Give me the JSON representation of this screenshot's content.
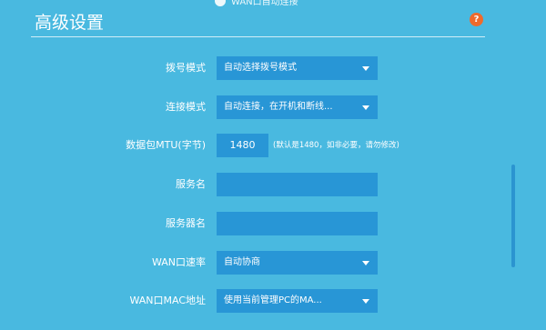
{
  "top_option": {
    "label": "WAN口自动连接"
  },
  "section": {
    "title": "高级设置",
    "help_icon": "question-icon"
  },
  "form": {
    "dial_mode": {
      "label": "拨号模式",
      "value": "自动选择拨号模式"
    },
    "connect_mode": {
      "label": "连接模式",
      "value": "自动连接，在开机和断线..."
    },
    "mtu": {
      "label": "数据包MTU(字节)",
      "value": "1480",
      "hint": "(默认是1480，如非必要，请勿修改)"
    },
    "service_name": {
      "label": "服务名",
      "value": ""
    },
    "server_name": {
      "label": "服务器名",
      "value": ""
    },
    "wan_speed": {
      "label": "WAN口速率",
      "value": "自动协商"
    },
    "wan_mac": {
      "label": "WAN口MAC地址",
      "value": "使用当前管理PC的MA..."
    }
  },
  "colors": {
    "background": "#49b9e0",
    "field": "#2896d6",
    "help": "#ef6a2c"
  }
}
